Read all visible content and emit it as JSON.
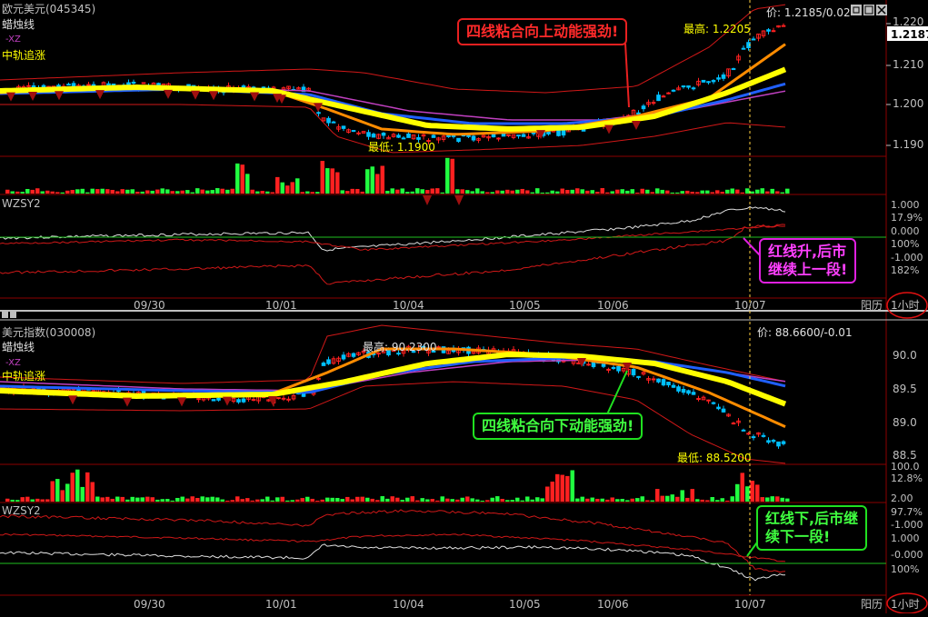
{
  "top_panel": {
    "title": "欧元美元(045345)",
    "indicator_name": "蜡烛线",
    "xz_label": "-XZ",
    "mid_label": "中轨追涨",
    "price_readout": "价: 1.2185/0.02",
    "high_label": "最高: 1.2205",
    "low_label": "最低: 1.1900",
    "current_price_box": "1.2187",
    "price_ticks": [
      "1.220",
      "1.210",
      "1.200",
      "1.190"
    ],
    "osc_name": "WZSY2",
    "osc_ticks": [
      "1.000",
      "17.9%",
      "0.000",
      "100%",
      "-1.000",
      "182%"
    ],
    "annotation_main": "四线粘合向上动能强劲!",
    "annotation_osc": "红线升,后市\n继续上一段!"
  },
  "bottom_panel": {
    "title": "美元指数(030008)",
    "indicator_name": "蜡烛线",
    "xz_label": "-XZ",
    "mid_label": "中轨追涨",
    "price_readout": "价: 88.6600/-0.01",
    "high_label": "最高: 90.2300",
    "low_label": "最低: 88.5200",
    "price_ticks": [
      "90.0",
      "89.5",
      "89.0",
      "88.5",
      "100.0"
    ],
    "vol_ticks": [
      "12.8%",
      "2.00"
    ],
    "osc_name": "WZSY2",
    "osc_ticks": [
      "97.7%",
      "-1.000",
      "1.000",
      "-0.000",
      "100%"
    ],
    "annotation_main": "四线粘合向下动能强劲!",
    "annotation_osc": "红线下,后市继\n续下一段!"
  },
  "date_axis": [
    "09/30",
    "10/01",
    "10/04",
    "10/05",
    "10/06",
    "10/07"
  ],
  "period_label": "阳历",
  "timeframe_label": "1小时",
  "colors": {
    "bg": "#000000",
    "grid": "#800000",
    "axis_text": "#c0c0c0",
    "up": "#ff2020",
    "down": "#20ff40",
    "yellow": "#ffff00",
    "orange": "#ff8c00",
    "blue": "#2060ff",
    "magenta": "#c040c0",
    "cyan": "#00c0ff"
  },
  "icons": [
    "window-restore-icon",
    "window-maximize-icon",
    "window-close-icon",
    "sell-arrow-icon"
  ]
}
